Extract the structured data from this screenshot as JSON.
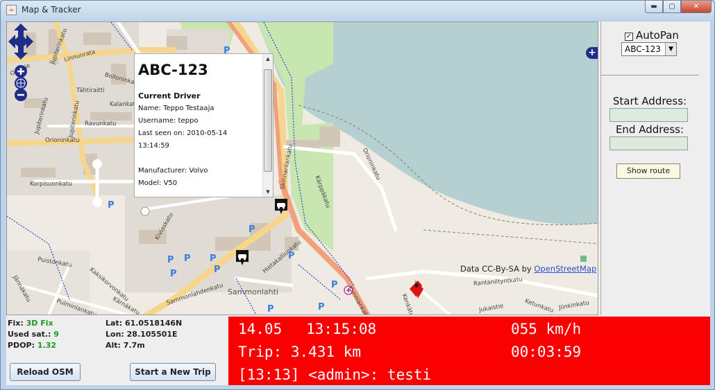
{
  "window": {
    "title": "Map & Tracker",
    "icon": "java-cup-icon",
    "buttons": {
      "minimize": "▬",
      "maximize": "▢",
      "close": "✕"
    }
  },
  "map": {
    "attribution_prefix": "Data CC-By-SA by",
    "attribution_link": "OpenStreetMap",
    "streets": [
      "Jupiterinkatu",
      "Linnunrata",
      "Jupiterinkatu",
      "Tähtiraitti",
      "Jupiterinkatu",
      "Opintie",
      "Bolloninkatu",
      "Kalankatu",
      "Ravunkatu",
      "Orioninkatu",
      "Korpisuonkatu",
      "Skinnarilankatu",
      "Orioninkatu",
      "Kärppäkatu",
      "Kiviaskatu",
      "Hietakallionkatu",
      "Sammonlahdenkatu",
      "Sammonlahti",
      "Rantaniityntkatu",
      "Puistonkatu",
      "Kaksikorvonkatu",
      "Pulminlankatu",
      "Jännäkatu",
      "Kärnäkatu",
      "Kunniankatu",
      "Kenkätu",
      "Ketunkatu",
      "Jukaistie",
      "Jiinkinkatu"
    ],
    "parking_symbol": "P",
    "controls": {
      "pan": "pan-control-icon",
      "zoom_in": "+",
      "world": "globe-icon",
      "zoom_out": "−",
      "layer_toggle": "+"
    }
  },
  "popup": {
    "vehicle_id": "ABC-123",
    "section_title": "Current Driver",
    "name_label": "Name:",
    "name_value": "Teppo Testaaja",
    "username_label": "Username:",
    "username_value": "teppo",
    "last_seen_label": "Last seen on:",
    "last_seen_date": "2010-05-14",
    "last_seen_time": "13:14:59",
    "manufacturer_label": "Manufacturer:",
    "manufacturer_value": "Volvo",
    "model_label": "Model:",
    "model_value": "V50"
  },
  "sidebar": {
    "autopan_label": "AutoPan",
    "autopan_checked": true,
    "vehicle_select_value": "ABC-123",
    "start_address_label": "Start Address:",
    "start_address_value": "",
    "end_address_label": "End Address:",
    "end_address_value": "",
    "show_route_label": "Show route"
  },
  "gps": {
    "fix_label": "Fix:",
    "fix_value": "3D Fix",
    "sat_label": "Used sat.:",
    "sat_value": "9",
    "pdop_label": "PDOP:",
    "pdop_value": "1.32",
    "lat_label": "Lat:",
    "lat_value": "61.0518146N",
    "lon_label": "Lon:",
    "lon_value": "28.105501E",
    "alt_label": "Alt:",
    "alt_value": "7.7m",
    "reload_osm_label": "Reload OSM",
    "new_trip_label": "Start a New Trip"
  },
  "ticker": {
    "date": "14.05",
    "time": "13:15:08",
    "speed": "055 km/h",
    "trip": "Trip: 3.431 km",
    "duration": "00:03:59",
    "message": "[13:13] <admin>: testi"
  },
  "colors": {
    "ticker_bg": "#fb0000",
    "water": "#b5d0d0",
    "forest": "#c8e6b0",
    "primary_road": "#f6d58c",
    "green_text": "#1a9a1a"
  }
}
